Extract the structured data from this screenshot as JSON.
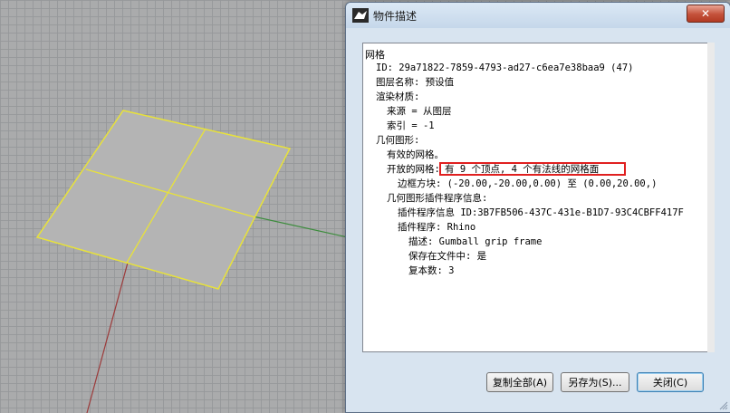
{
  "dialog": {
    "title": "物件描述",
    "close_label": "✕",
    "lines": [
      "网格",
      "ID: 29a71822-7859-4793-ad27-c6ea7e38baa9 (47)",
      "图层名称: 预设值",
      "渲染材质:",
      "来源 = 从图层",
      "索引 = -1",
      "几何图形:",
      "有效的网格。",
      "开放的网格:",
      "有 9 个顶点, 4 个有法线的网格面",
      "边框方块: (-20.00,-20.00,0.00) 至 (0.00,20.00,)",
      "几何图形插件程序信息:",
      "插件程序信息 ID:3B7FB506-437C-431e-B1D7-93C4CBFF417F",
      "插件程序: Rhino",
      "描述: Gumball grip frame",
      "保存在文件中: 是",
      "复本数: 3"
    ],
    "buttons": {
      "copy_all": "复制全部(A)",
      "save_as": "另存为(S)...",
      "close": "关闭(C)"
    }
  },
  "colors": {
    "mesh_edge": "#e8e23a",
    "x_axis": "#9c3a3a",
    "y_axis": "#3c8c3c",
    "highlight_border": "#e02020"
  }
}
